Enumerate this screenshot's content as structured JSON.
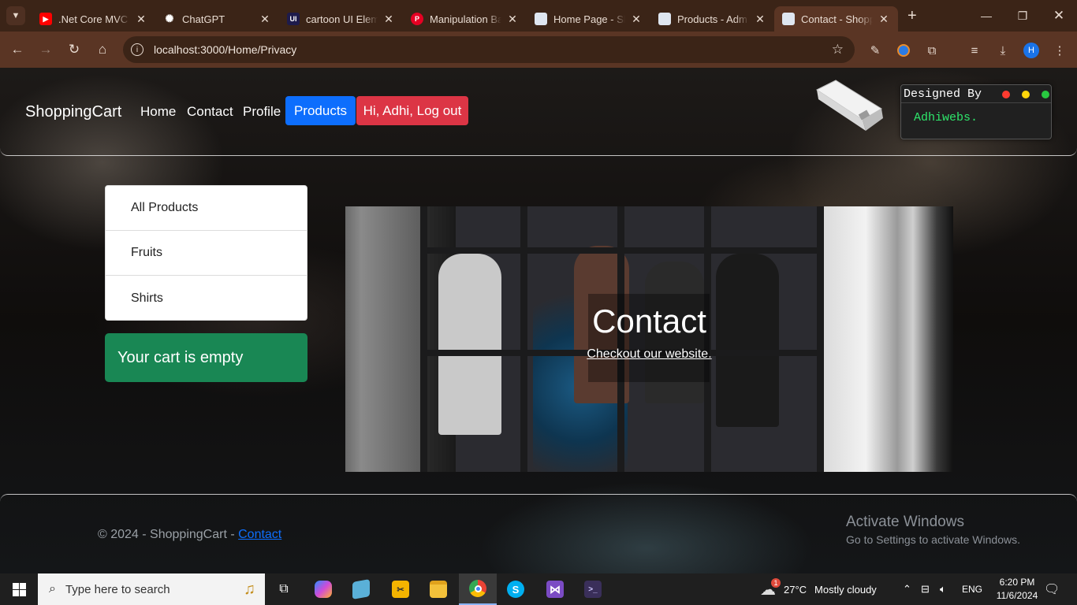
{
  "browser": {
    "tabs": [
      {
        "title": ".Net Core MVC (",
        "favicon": "youtube-icon",
        "color": "#ff0000"
      },
      {
        "title": "ChatGPT",
        "favicon": "chatgpt-icon",
        "color": "#ffffff"
      },
      {
        "title": "cartoon UI Eleme",
        "favicon": "uiverse-icon",
        "color": "#1e1b4b"
      },
      {
        "title": "Manipulation Ba",
        "favicon": "pinterest-icon",
        "color": "#e60023"
      },
      {
        "title": "Home Page - Sh",
        "favicon": "page-icon",
        "color": "#dfe6f0"
      },
      {
        "title": "Products - Adm",
        "favicon": "page-icon",
        "color": "#dfe6f0"
      },
      {
        "title": "Contact - Shopp",
        "favicon": "page-icon",
        "color": "#dfe6f0"
      }
    ],
    "active_tab_index": 6,
    "url": "localhost:3000/Home/Privacy"
  },
  "site": {
    "brand": "ShoppingCart",
    "nav": {
      "home": "Home",
      "contact": "Contact",
      "profile": "Profile",
      "products": "Products",
      "logout": "Hi, Adhi, Log out"
    },
    "designer": {
      "title": "Designed By",
      "text": "Adhiwebs.",
      "dot_colors": [
        "#ff3b30",
        "#ffd60a",
        "#28c840"
      ]
    },
    "categories": [
      "All Products",
      "Fruits",
      "Shirts"
    ],
    "cart_status": "Your cart is empty",
    "hero": {
      "title": "Contact",
      "link": "Checkout our website."
    },
    "footer": {
      "text": "© 2024 - ShoppingCart - ",
      "link": "Contact"
    },
    "colors": {
      "primary": "#0d6efd",
      "danger": "#dc3545",
      "success": "#198754"
    }
  },
  "os": {
    "activation": {
      "title": "Activate Windows",
      "subtitle": "Go to Settings to activate Windows."
    },
    "search_placeholder": "Type here to search",
    "weather": {
      "temp": "27°C",
      "condition": "Mostly cloudy",
      "badge": "1"
    },
    "language": "ENG",
    "time": "6:20 PM",
    "date": "11/6/2024"
  }
}
